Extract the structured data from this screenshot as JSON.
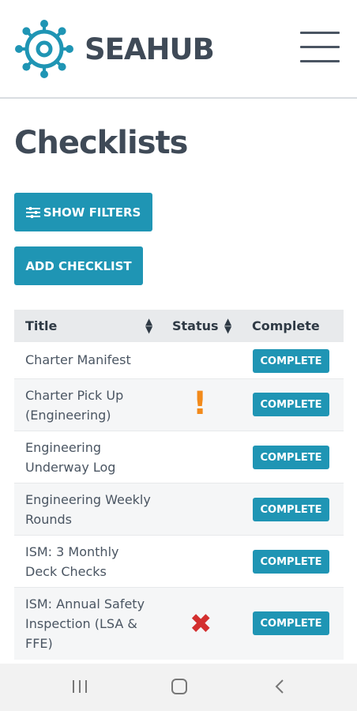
{
  "header": {
    "brand": "SEAHUB",
    "logo_icon": "ship-wheel-icon",
    "menu_icon": "hamburger-menu-icon"
  },
  "page": {
    "title": "Checklists",
    "show_filters_label": "SHOW FILTERS",
    "filter_icon": "sliders-icon",
    "add_checklist_label": "ADD CHECKLIST"
  },
  "table": {
    "columns": [
      "Title",
      "Status",
      "Complete"
    ],
    "rows": [
      {
        "title_lines": [
          "Charter Manifest"
        ],
        "status": "",
        "action": "COMPLETE"
      },
      {
        "title_lines": [
          "Charter Pick Up",
          "(Engineering)"
        ],
        "status": "warning",
        "status_glyph": "!",
        "action": "COMPLETE"
      },
      {
        "title_lines": [
          "Engineering",
          "Underway Log"
        ],
        "status": "",
        "action": "COMPLETE"
      },
      {
        "title_lines": [
          "Engineering Weekly",
          "Rounds"
        ],
        "status": "",
        "action": "COMPLETE"
      },
      {
        "title_lines": [
          "ISM: 3 Monthly",
          "Deck Checks"
        ],
        "status": "",
        "action": "COMPLETE"
      },
      {
        "title_lines": [
          "ISM: Annual Safety",
          "Inspection (LSA &",
          "FFE)"
        ],
        "status": "failed",
        "status_glyph": "✖",
        "action": "COMPLETE"
      }
    ]
  },
  "colors": {
    "accent": "#1f95b4",
    "warning": "#f28a1b",
    "error": "#d32f2f",
    "text": "#3f4a57"
  },
  "system_nav": {
    "recent_icon": "recent-apps-icon",
    "home_icon": "home-icon",
    "back_icon": "back-icon"
  }
}
